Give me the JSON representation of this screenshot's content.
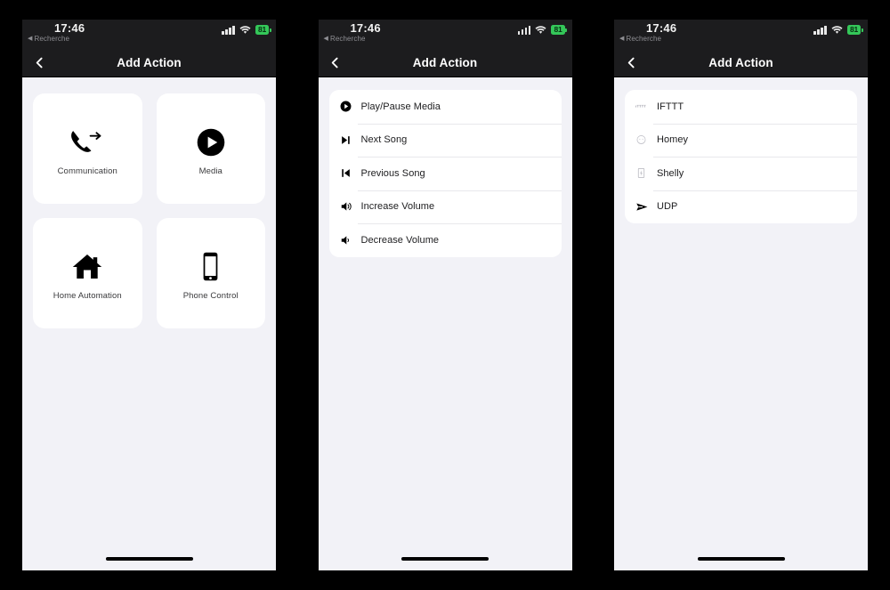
{
  "app": {
    "screen_title": "Add Action",
    "background_color": "#000000",
    "page_background": "#F2F2F7",
    "navbar_color": "#1C1C1E",
    "card_color": "#FFFFFF",
    "accent_battery": "#34C759"
  },
  "status_bar": {
    "time": "17:46",
    "back_app": "Recherche",
    "back_arrow": "◀",
    "battery_level": "81",
    "signal_icon": "cellular-signal-icon",
    "wifi_icon": "wifi-icon",
    "battery_icon": "battery-charging-icon"
  },
  "navbar": {
    "title": "Add Action",
    "back_icon": "chevron-left-icon"
  },
  "panels": [
    {
      "id": "categories",
      "type": "grid",
      "tiles": [
        {
          "label": "Communication",
          "icon": "phone-forward-icon"
        },
        {
          "label": "Media",
          "icon": "play-circle-icon"
        },
        {
          "label": "Home Automation",
          "icon": "house-icon"
        },
        {
          "label": "Phone Control",
          "icon": "smartphone-icon"
        }
      ]
    },
    {
      "id": "media-actions",
      "type": "list",
      "rows": [
        {
          "label": "Play/Pause Media",
          "icon": "play-circle-icon"
        },
        {
          "label": "Next Song",
          "icon": "skip-forward-icon"
        },
        {
          "label": "Previous Song",
          "icon": "skip-backward-icon"
        },
        {
          "label": "Increase Volume",
          "icon": "volume-up-icon"
        },
        {
          "label": "Decrease Volume",
          "icon": "volume-down-icon"
        }
      ]
    },
    {
      "id": "home-automation-services",
      "type": "list",
      "rows": [
        {
          "label": "IFTTT",
          "icon": "ifttt-logo-icon"
        },
        {
          "label": "Homey",
          "icon": "homey-logo-icon"
        },
        {
          "label": "Shelly",
          "icon": "shelly-device-icon"
        },
        {
          "label": "UDP",
          "icon": "send-paper-plane-icon"
        }
      ]
    }
  ]
}
